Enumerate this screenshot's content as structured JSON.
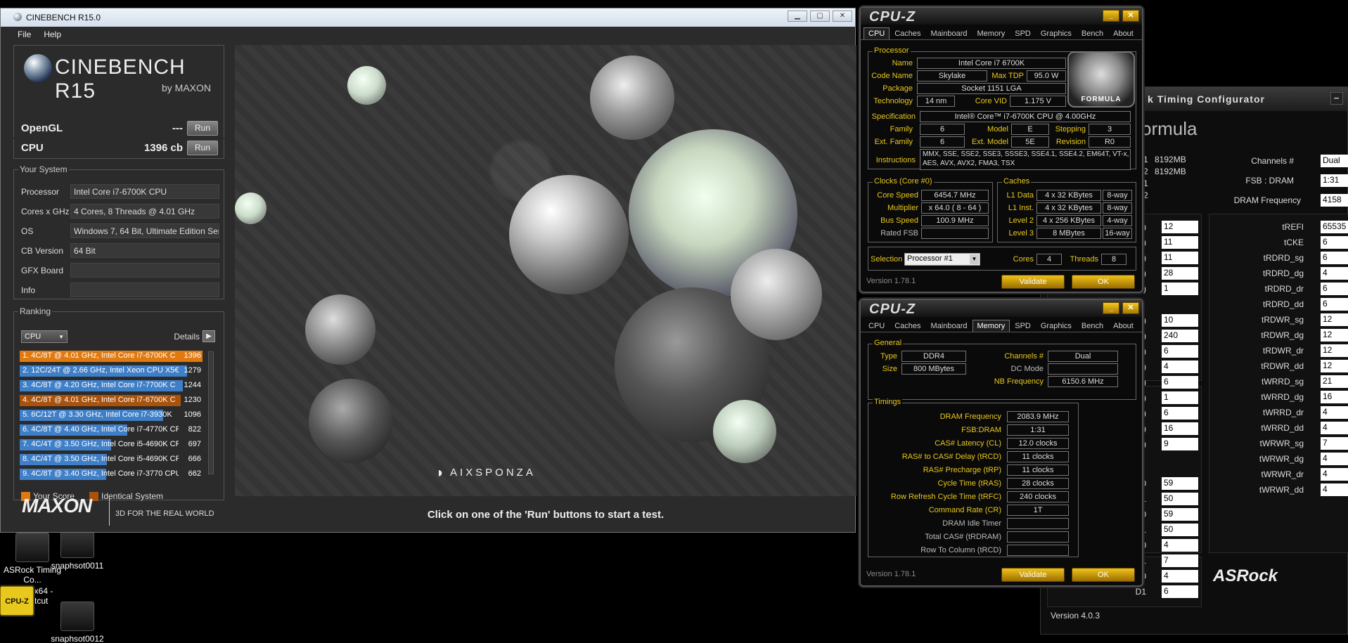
{
  "desktop": {
    "icons": [
      {
        "label": "ASRock Timing Co...",
        "icon": "asrock-timing-icon"
      },
      {
        "label": "snaphsot0011",
        "icon": "snapshot-icon"
      },
      {
        "label": "cpuz_x64 - Shortcut",
        "icon": "cpuz-icon",
        "badge": "CPU-Z"
      },
      {
        "label": "snaphsot0012",
        "icon": "snapshot-icon"
      }
    ]
  },
  "asrock": {
    "title": "Timing Configurator",
    "title_prefix": "k",
    "close": "−",
    "heading": "ormula",
    "dimm_rows": [
      {
        "slot": "A1",
        "size": "8192MB"
      },
      {
        "slot": "A2",
        "size": "8192MB"
      },
      {
        "slot": "B1",
        "size": ""
      },
      {
        "slot": "B2",
        "size": ""
      }
    ],
    "channels_label": "Channels #",
    "channels_value": "Dual",
    "fsb_label": "FSB : DRAM",
    "fsb_value": "1:31",
    "dram_freq_label": "DRAM Frequency",
    "dram_freq_value": "4158",
    "left_col": [
      {
        "label": "L)",
        "value": "12"
      },
      {
        "label": "D)",
        "value": "11"
      },
      {
        "label": "P)",
        "value": "11"
      },
      {
        "label": "S)",
        "value": "28"
      },
      {
        "label": "R)",
        "value": "1"
      },
      {
        "label": "R)",
        "value": "10"
      },
      {
        "label": "C)",
        "value": "240"
      },
      {
        "label": "L)",
        "value": "6"
      },
      {
        "label": "S)",
        "value": "4"
      },
      {
        "label": "S)",
        "value": "6"
      },
      {
        "label": "S)",
        "value": "1"
      },
      {
        "label": "P)",
        "value": "6"
      },
      {
        "label": "V)",
        "value": "16"
      },
      {
        "label": "/L)",
        "value": "9"
      },
      {
        "label": "D0",
        "value": "59"
      },
      {
        "label": "D1",
        "value": "50"
      },
      {
        "label": "D0",
        "value": "59"
      },
      {
        "label": "D1",
        "value": "50"
      },
      {
        "label": "D0",
        "value": "4"
      },
      {
        "label": "D1",
        "value": "7"
      },
      {
        "label": "D0",
        "value": "4"
      },
      {
        "label": "D1",
        "value": "6"
      }
    ],
    "right_col": [
      {
        "label": "tREFI",
        "value": "65535"
      },
      {
        "label": "tCKE",
        "value": "6"
      },
      {
        "label": "tRDRD_sg",
        "value": "6"
      },
      {
        "label": "tRDRD_dg",
        "value": "4"
      },
      {
        "label": "tRDRD_dr",
        "value": "6"
      },
      {
        "label": "tRDRD_dd",
        "value": "6"
      },
      {
        "label": "tRDWR_sg",
        "value": "12"
      },
      {
        "label": "tRDWR_dg",
        "value": "12"
      },
      {
        "label": "tRDWR_dr",
        "value": "12"
      },
      {
        "label": "tRDWR_dd",
        "value": "12"
      },
      {
        "label": "tWRRD_sg",
        "value": "21"
      },
      {
        "label": "tWRRD_dg",
        "value": "16"
      },
      {
        "label": "tWRRD_dr",
        "value": "4"
      },
      {
        "label": "tWRRD_dd",
        "value": "4"
      },
      {
        "label": "tWRWR_sg",
        "value": "7"
      },
      {
        "label": "tWRWR_dg",
        "value": "4"
      },
      {
        "label": "tWRWR_dr",
        "value": "4"
      },
      {
        "label": "tWRWR_dd",
        "value": "4"
      }
    ],
    "logo": "ASRock",
    "version": "Version 4.0.3"
  },
  "cinebench": {
    "window_title": "CINEBENCH R15.0",
    "window_buttons": [
      "▁",
      "▢",
      "✕"
    ],
    "menu": [
      "File",
      "Help"
    ],
    "logo_main": "CINEBENCH R15",
    "logo_by": "by MAXON",
    "opengl_label": "OpenGL",
    "opengl_score": "---",
    "cpu_label": "CPU",
    "cpu_score": "1396 cb",
    "run_label": "Run",
    "your_system_label": "Your System",
    "system": [
      {
        "key": "Processor",
        "value": "Intel Core i7-6700K CPU"
      },
      {
        "key": "Cores x GHz",
        "value": "4 Cores, 8 Threads @ 4.01 GHz"
      },
      {
        "key": "OS",
        "value": "Windows 7, 64 Bit, Ultimate Edition Ser"
      },
      {
        "key": "CB Version",
        "value": "64 Bit"
      },
      {
        "key": "GFX Board",
        "value": ""
      },
      {
        "key": "Info",
        "value": ""
      }
    ],
    "ranking_label": "Ranking",
    "ranking_select": "CPU",
    "details_label": "Details",
    "ranking": [
      {
        "text": "1. 4C/8T @ 4.01 GHz, Intel Core i7-6700K C",
        "score": "1396",
        "type": "your",
        "fraction": 1.0
      },
      {
        "text": "2. 12C/24T @ 2.66 GHz, Intel Xeon CPU X5€",
        "score": "1279",
        "type": "ref",
        "fraction": 0.916
      },
      {
        "text": "3. 4C/8T @ 4.20 GHz, Intel Core i7-7700K C",
        "score": "1244",
        "type": "ref",
        "fraction": 0.891
      },
      {
        "text": "4. 4C/8T @ 4.01 GHz, Intel Core i7-6700K C",
        "score": "1230",
        "type": "identical",
        "fraction": 0.881
      },
      {
        "text": "5. 6C/12T @ 3.30 GHz,  Intel Core i7-3930K",
        "score": "1096",
        "type": "ref",
        "fraction": 0.785
      },
      {
        "text": "6. 4C/8T @ 4.40 GHz, Intel Core i7-4770K CP",
        "score": "822",
        "type": "ref",
        "fraction": 0.589
      },
      {
        "text": "7. 4C/4T @ 3.50 GHz, Intel Core i5-4690K CP",
        "score": "697",
        "type": "ref",
        "fraction": 0.499
      },
      {
        "text": "8. 4C/4T @ 3.50 GHz, Intel Core i5-4690K CP",
        "score": "666",
        "type": "ref",
        "fraction": 0.477
      },
      {
        "text": "9. 4C/8T @ 3.40 GHz,  Intel Core i7-3770 CPU",
        "score": "662",
        "type": "ref",
        "fraction": 0.474
      }
    ],
    "legend_your": "Your Score",
    "legend_identical": "Identical System",
    "maxon_logo": "MAXON",
    "maxon_tagline": "3D FOR THE REAL WORLD",
    "render_credit": "AIXSPONZA",
    "status_text": "Click on one of the 'Run' buttons to start a test.",
    "colors": {
      "your": "#e07a10",
      "identical": "#a8520c",
      "ref": "#3f7fc8"
    }
  },
  "cpuz_cpu": {
    "logo": "CPU-Z",
    "tabs": [
      "CPU",
      "Caches",
      "Mainboard",
      "Memory",
      "SPD",
      "Graphics",
      "Bench",
      "About"
    ],
    "active_tab": "CPU",
    "processor_group": "Processor",
    "name_label": "Name",
    "name": "Intel Core i7 6700K",
    "codename_label": "Code Name",
    "codename": "Skylake",
    "maxtdp_label": "Max TDP",
    "maxtdp": "95.0 W",
    "package_label": "Package",
    "package": "Socket 1151 LGA",
    "technology_label": "Technology",
    "technology": "14 nm",
    "corevid_label": "Core VID",
    "corevid": "1.175 V",
    "spec_label": "Specification",
    "spec": "Intel® Core™ i7-6700K CPU @ 4.00GHz",
    "family_label": "Family",
    "family": "6",
    "model_label": "Model",
    "model": "E",
    "stepping_label": "Stepping",
    "stepping": "3",
    "extfamily_label": "Ext. Family",
    "extfamily": "6",
    "extmodel_label": "Ext. Model",
    "extmodel": "5E",
    "revision_label": "Revision",
    "revision": "R0",
    "instr_label": "Instructions",
    "instr": "MMX, SSE, SSE2, SSE3, SSSE3, SSE4.1, SSE4.2, EM64T, VT-x, AES, AVX, AVX2, FMA3, TSX",
    "clocks_group": "Clocks (Core #0)",
    "corespeed_label": "Core Speed",
    "corespeed": "6454.7 MHz",
    "multiplier_label": "Multiplier",
    "multiplier": "x 64.0 ( 8 - 64 )",
    "busspeed_label": "Bus Speed",
    "busspeed": "100.9 MHz",
    "ratedfsb_label": "Rated FSB",
    "ratedfsb": "",
    "caches_group": "Caches",
    "caches": [
      {
        "label": "L1 Data",
        "size": "4 x 32 KBytes",
        "way": "8-way"
      },
      {
        "label": "L1 Inst.",
        "size": "4 x 32 KBytes",
        "way": "8-way"
      },
      {
        "label": "Level 2",
        "size": "4 x 256 KBytes",
        "way": "4-way"
      },
      {
        "label": "Level 3",
        "size": "8 MBytes",
        "way": "16-way"
      }
    ],
    "selection_label": "Selection",
    "selection": "Processor #1",
    "cores_label": "Cores",
    "cores": "4",
    "threads_label": "Threads",
    "threads": "8",
    "version": "Version 1.78.1",
    "validate": "Validate",
    "ok": "OK",
    "formula_text": "FORMULA"
  },
  "cpuz_mem": {
    "logo": "CPU-Z",
    "tabs": [
      "CPU",
      "Caches",
      "Mainboard",
      "Memory",
      "SPD",
      "Graphics",
      "Bench",
      "About"
    ],
    "active_tab": "Memory",
    "general_group": "General",
    "type_label": "Type",
    "type": "DDR4",
    "size_label": "Size",
    "size": "800 MBytes",
    "channels_label": "Channels #",
    "channels": "Dual",
    "dcmode_label": "DC Mode",
    "dcmode": "",
    "nbfreq_label": "NB Frequency",
    "nbfreq": "6150.6 MHz",
    "timings_group": "Timings",
    "timings": [
      {
        "label": "DRAM Frequency",
        "value": "2083.9 MHz",
        "active": true
      },
      {
        "label": "FSB:DRAM",
        "value": "1:31",
        "active": true
      },
      {
        "label": "CAS# Latency (CL)",
        "value": "12.0 clocks",
        "active": true
      },
      {
        "label": "RAS# to CAS# Delay (tRCD)",
        "value": "11 clocks",
        "active": true
      },
      {
        "label": "RAS# Precharge (tRP)",
        "value": "11 clocks",
        "active": true
      },
      {
        "label": "Cycle Time (tRAS)",
        "value": "28 clocks",
        "active": true
      },
      {
        "label": "Row Refresh Cycle Time (tRFC)",
        "value": "240 clocks",
        "active": true
      },
      {
        "label": "Command Rate (CR)",
        "value": "1T",
        "active": true
      },
      {
        "label": "DRAM Idle Timer",
        "value": "",
        "active": false
      },
      {
        "label": "Total CAS# (tRDRAM)",
        "value": "",
        "active": false
      },
      {
        "label": "Row To Column (tRCD)",
        "value": "",
        "active": false
      }
    ],
    "version": "Version 1.78.1",
    "validate": "Validate",
    "ok": "OK"
  }
}
